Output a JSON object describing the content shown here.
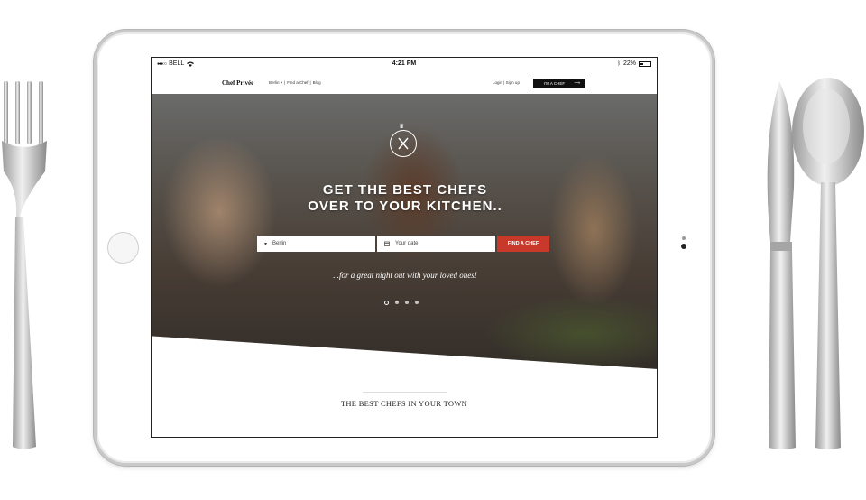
{
  "status_bar": {
    "signal": "●●●○○",
    "carrier": "BELL",
    "time": "4:21 PM",
    "battery": "22%"
  },
  "nav": {
    "logo": "Chef Privée",
    "links": [
      "Berlin ▾",
      "|",
      "Find a Chef",
      "|",
      "Blog"
    ],
    "auth": "Login | Sign up",
    "chef_button": "I'M A CHEF",
    "chef_arrow": "⟶"
  },
  "hero": {
    "headline_line1": "GET THE BEST CHEFS",
    "headline_line2": "OVER TO YOUR KITCHEN..",
    "tagline": "...for a great night out with your loved ones!",
    "city_value": "Berlin",
    "date_placeholder": "Your date",
    "find_button": "FIND A CHEF",
    "slide_index": 0,
    "slide_count": 4
  },
  "section": {
    "title": "THE BEST CHEFS IN YOUR TOWN"
  },
  "colors": {
    "accent": "#c8392b",
    "dark": "#111111"
  },
  "icons": [
    "fork-icon",
    "knife-icon",
    "spoon-icon",
    "location-pin-icon",
    "calendar-icon",
    "chef-emblem-icon",
    "crown-icon",
    "wifi-icon",
    "bluetooth-icon"
  ]
}
